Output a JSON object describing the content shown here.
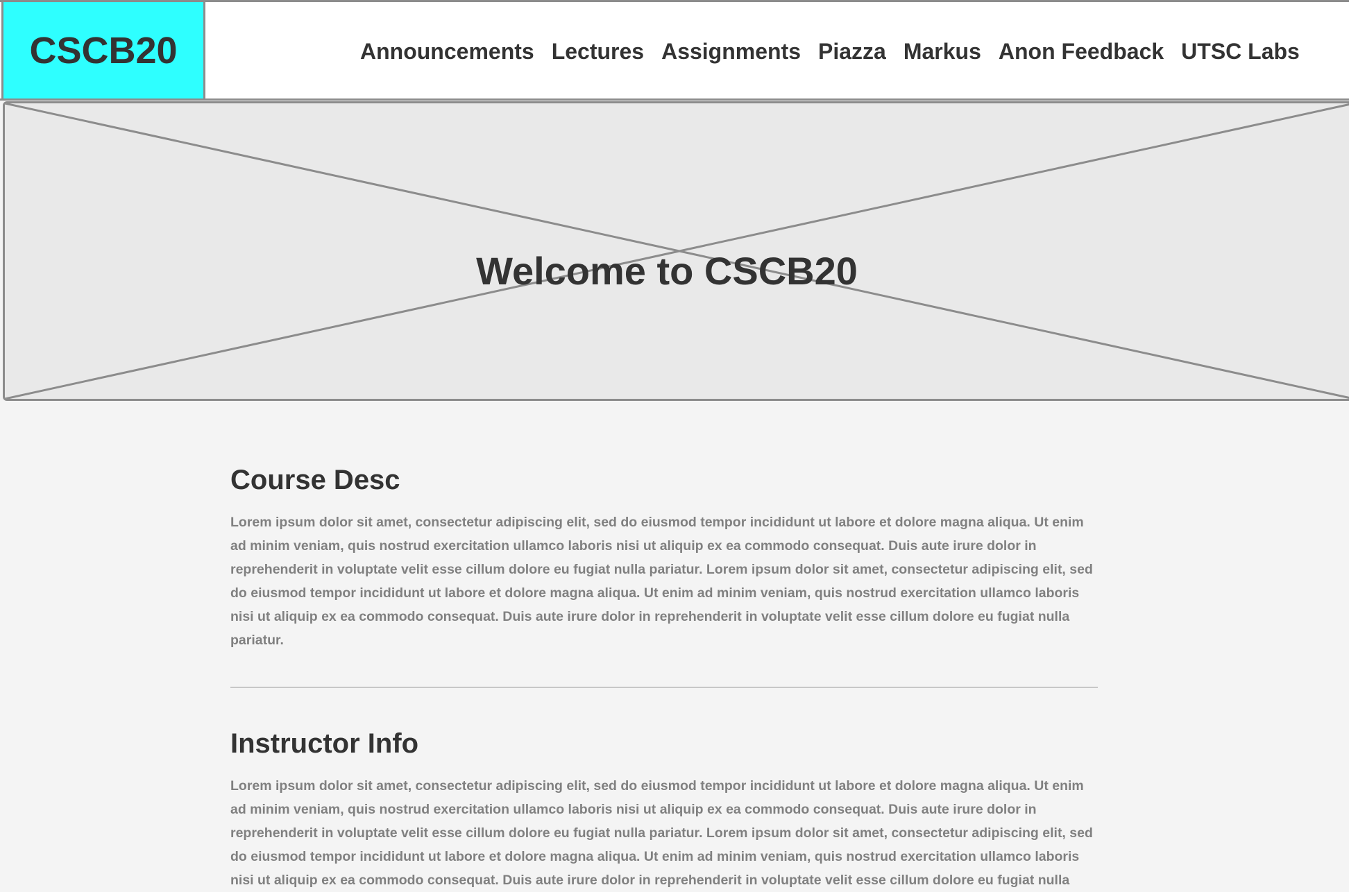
{
  "header": {
    "logo_text": "CSCB20",
    "nav": [
      {
        "label": "Announcements"
      },
      {
        "label": "Lectures"
      },
      {
        "label": "Assignments"
      },
      {
        "label": "Piazza"
      },
      {
        "label": "Markus"
      },
      {
        "label": "Anon Feedback"
      },
      {
        "label": "UTSC Labs"
      }
    ]
  },
  "hero": {
    "title": "Welcome to CSCB20"
  },
  "sections": [
    {
      "heading": "Course Desc",
      "body": "Lorem ipsum dolor sit amet, consectetur adipiscing elit, sed do eiusmod tempor incididunt ut labore et dolore magna aliqua. Ut enim ad minim veniam, quis nostrud exercitation ullamco laboris nisi ut aliquip ex ea commodo consequat. Duis aute irure dolor in reprehenderit in voluptate velit esse cillum dolore eu fugiat nulla pariatur. Lorem ipsum dolor sit amet, consectetur adipiscing elit, sed do eiusmod tempor incididunt ut labore et dolore magna aliqua. Ut enim ad minim veniam, quis nostrud exercitation ullamco laboris nisi ut aliquip ex ea commodo consequat. Duis aute irure dolor in reprehenderit in voluptate velit esse cillum dolore eu fugiat nulla pariatur."
    },
    {
      "heading": "Instructor Info",
      "body": "Lorem ipsum dolor sit amet, consectetur adipiscing elit, sed do eiusmod tempor incididunt ut labore et dolore magna aliqua. Ut enim ad minim veniam, quis nostrud exercitation ullamco laboris nisi ut aliquip ex ea commodo consequat. Duis aute irure dolor in reprehenderit in voluptate velit esse cillum dolore eu fugiat nulla pariatur. Lorem ipsum dolor sit amet, consectetur adipiscing elit, sed do eiusmod tempor incididunt ut labore et dolore magna aliqua. Ut enim ad minim veniam, quis nostrud exercitation ullamco laboris nisi ut aliquip ex ea commodo consequat. Duis aute irure dolor in reprehenderit in voluptate velit esse cillum dolore eu fugiat nulla pariatur."
    }
  ],
  "colors": {
    "logo_background": "#2effff",
    "page_background": "#f4f4f4",
    "hero_background": "#e9e9e9",
    "border": "#8c8c8c",
    "heading_text": "#333333",
    "body_text": "#808080"
  }
}
